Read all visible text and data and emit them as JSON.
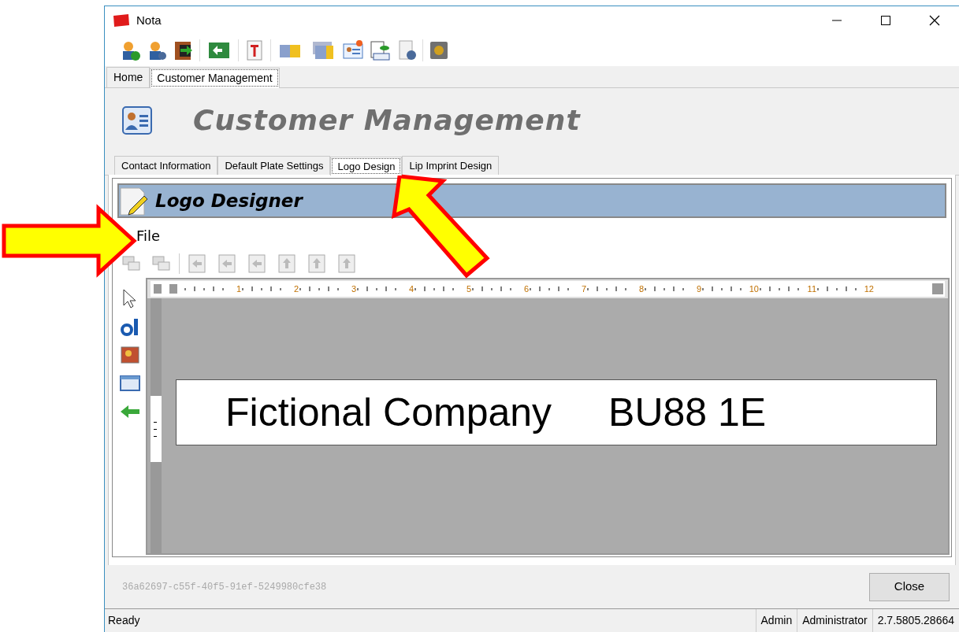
{
  "window": {
    "title": "Nota"
  },
  "app_tabs": [
    {
      "label": "Home",
      "selected": false
    },
    {
      "label": "Customer Management",
      "selected": true
    }
  ],
  "header": {
    "title": "Customer Management"
  },
  "section_tabs": [
    {
      "label": "Contact Information",
      "selected": false
    },
    {
      "label": "Default Plate Settings",
      "selected": false
    },
    {
      "label": "Logo Design",
      "selected": true
    },
    {
      "label": "Lip Imprint Design",
      "selected": false
    }
  ],
  "designer": {
    "title": "Logo Designer",
    "menu": [
      "File"
    ],
    "ruler": [
      "1",
      "2",
      "3",
      "4",
      "5",
      "6",
      "7",
      "8",
      "9",
      "10",
      "11",
      "12"
    ],
    "logo_text": [
      "Fictional Company",
      "BU88 1E"
    ]
  },
  "footer": {
    "record_id": "36a62697-c55f-40f5-91ef-5249980cfe38",
    "button": "Close"
  },
  "status_bar": {
    "message": "Ready",
    "panels": [
      "Admin",
      "Administrator",
      "2.7.5805.28664"
    ]
  }
}
